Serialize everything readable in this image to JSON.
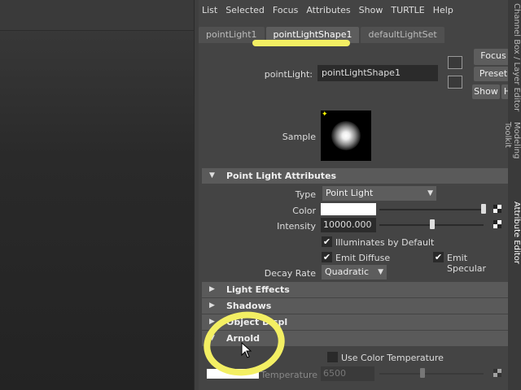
{
  "menubar": [
    "List",
    "Selected",
    "Focus",
    "Attributes",
    "Show",
    "TURTLE",
    "Help"
  ],
  "tabs": [
    {
      "label": "pointLight1",
      "active": false
    },
    {
      "label": "pointLightShape1",
      "active": true
    },
    {
      "label": "defaultLightSet",
      "active": false
    }
  ],
  "node": {
    "label": "pointLight:",
    "value": "pointLightShape1"
  },
  "side_buttons": {
    "focus": "Focus",
    "presets": "Preset",
    "show": "Show",
    "hide": "H"
  },
  "sample_label": "Sample",
  "sections": {
    "point_light": "Point Light Attributes",
    "light_effects": "Light Effects",
    "shadows": "Shadows",
    "object_display": "Object Displ",
    "arnold": "Arnold"
  },
  "point_light": {
    "type_label": "Type",
    "type_value": "Point Light",
    "color_label": "Color",
    "color_value": "#ffffff",
    "intensity_label": "Intensity",
    "intensity_value": "10000.000",
    "intensity_slider": 0.51,
    "illuminates_label": "Illuminates by Default",
    "emit_diffuse_label": "Emit Diffuse",
    "emit_specular_label": "Emit Specular",
    "decay_label": "Decay Rate",
    "decay_value": "Quadratic"
  },
  "arnold": {
    "use_color_temp_label": "Use Color Temperature",
    "temperature_label": "Temperature",
    "temperature_value": "6500"
  },
  "side_panel_tabs": [
    "Channel Box / Layer Editor",
    "Modeling Toolkit",
    "Attribute Editor"
  ],
  "highlight_color": "#f3ef63"
}
